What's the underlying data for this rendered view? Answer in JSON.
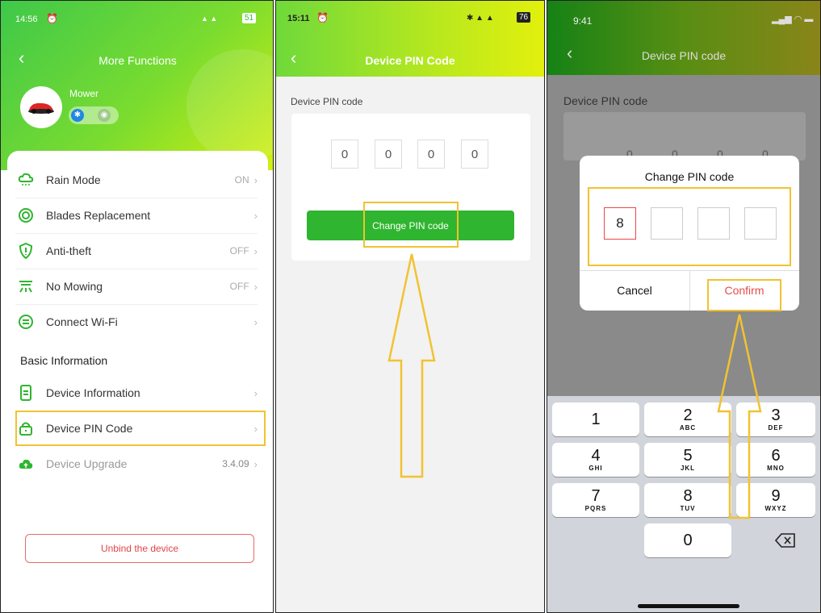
{
  "panel1": {
    "status_time": "14:56",
    "status_battery": "51",
    "nav_title": "More Functions",
    "device_name": "Mower",
    "settings": [
      {
        "icon": "cloud-rain-icon",
        "label": "Rain Mode",
        "value": "ON"
      },
      {
        "icon": "blade-icon",
        "label": "Blades Replacement",
        "value": ""
      },
      {
        "icon": "shield-icon",
        "label": "Anti-theft",
        "value": "OFF"
      },
      {
        "icon": "no-mowing-icon",
        "label": "No Mowing",
        "value": "OFF"
      },
      {
        "icon": "wifi-connect-icon",
        "label": "Connect Wi-Fi",
        "value": ""
      }
    ],
    "section_title": "Basic Information",
    "info": [
      {
        "icon": "document-icon",
        "label": "Device Information",
        "value": ""
      },
      {
        "icon": "lock-icon",
        "label": "Device PIN Code",
        "value": ""
      },
      {
        "icon": "cloud-upload-icon",
        "label": "Device Upgrade",
        "value": "3.4.09"
      }
    ],
    "unbind_label": "Unbind the device"
  },
  "panel2": {
    "status_time": "15:11",
    "status_battery": "76",
    "nav_title": "Device PIN Code",
    "field_label": "Device PIN code",
    "digits": [
      "0",
      "0",
      "0",
      "0"
    ],
    "button_label": "Change PIN code"
  },
  "panel3": {
    "status_time": "9:41",
    "nav_title": "Device PIN code",
    "field_label": "Device PIN code",
    "bg_digits": [
      "0",
      "0",
      "0",
      "0"
    ],
    "dialog_title": "Change PIN code",
    "entry_digits": [
      "8",
      "",
      "",
      ""
    ],
    "cancel_label": "Cancel",
    "confirm_label": "Confirm",
    "keys": [
      {
        "n": "1",
        "s": ""
      },
      {
        "n": "2",
        "s": "ABC"
      },
      {
        "n": "3",
        "s": "DEF"
      },
      {
        "n": "4",
        "s": "GHI"
      },
      {
        "n": "5",
        "s": "JKL"
      },
      {
        "n": "6",
        "s": "MNO"
      },
      {
        "n": "7",
        "s": "PQRS"
      },
      {
        "n": "8",
        "s": "TUV"
      },
      {
        "n": "9",
        "s": "WXYZ"
      },
      {
        "n": "0",
        "s": ""
      }
    ]
  },
  "colors": {
    "brand_green": "#2fb52f",
    "highlight": "#f2c230",
    "confirm_red": "#e84a4a"
  }
}
